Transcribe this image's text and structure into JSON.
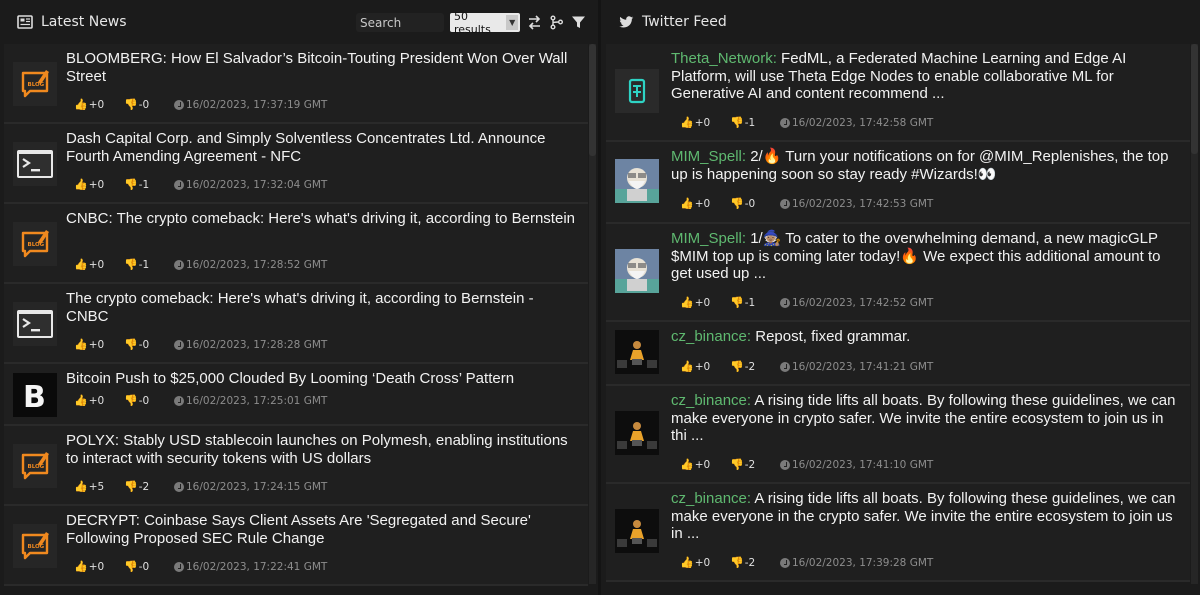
{
  "news": {
    "title": "Latest News",
    "search_placeholder": "Search",
    "results_label": "50 results",
    "items": [
      {
        "title": "BLOOMBERG: How El Salvador’s Bitcoin-Touting President Won Over Wall Street",
        "icon": "blog-icon",
        "up": "+0",
        "down": "-0",
        "time": "16/02/2023, 17:37:19 GMT"
      },
      {
        "title": "Dash Capital Corp. and Simply Solventless Concentrates Ltd. Announce Fourth Amending Agreement - NFC",
        "icon": "terminal-icon",
        "up": "+0",
        "down": "-1",
        "time": "16/02/2023, 17:32:04 GMT"
      },
      {
        "title": "CNBC: The crypto comeback: Here's what's driving it, according to Bernstein",
        "icon": "blog-icon",
        "up": "+0",
        "down": "-1",
        "time": "16/02/2023, 17:28:52 GMT"
      },
      {
        "title": "The crypto comeback: Here's what's driving it, according to Bernstein - CNBC",
        "icon": "terminal-icon",
        "up": "+0",
        "down": "-0",
        "time": "16/02/2023, 17:28:28 GMT"
      },
      {
        "title": "Bitcoin Push to $25,000 Clouded By Looming ‘Death Cross’ Pattern",
        "icon": "b-logo-icon",
        "up": "+0",
        "down": "-0",
        "time": "16/02/2023, 17:25:01 GMT"
      },
      {
        "title": "POLYX: Stably USD stablecoin launches on Polymesh, enabling institutions to interact with security tokens with US dollars",
        "icon": "blog-icon",
        "up": "+5",
        "down": "-2",
        "time": "16/02/2023, 17:24:15 GMT"
      },
      {
        "title": "DECRYPT: Coinbase Says Client Assets Are 'Segregated and Secure' Following Proposed SEC Rule Change",
        "icon": "blog-icon",
        "up": "+0",
        "down": "-0",
        "time": "16/02/2023, 17:22:41 GMT"
      }
    ]
  },
  "twitter": {
    "title": "Twitter Feed",
    "items": [
      {
        "handle": "Theta_Network:",
        "text": " FedML, a Federated Machine Learning and Edge AI Platform, will use Theta Edge Nodes to enable collaborative ML for Generative AI and content recommend ...",
        "icon": "theta-avatar-icon",
        "up": "+0",
        "down": "-1",
        "time": "16/02/2023, 17:42:58 GMT"
      },
      {
        "handle": "MIM_Spell:",
        "text": " 2/🔥 Turn your notifications on for @MIM_Replenishes, the top up is happening soon so stay ready #Wizards!👀",
        "icon": "wizard-avatar-icon",
        "up": "+0",
        "down": "-0",
        "time": "16/02/2023, 17:42:53 GMT"
      },
      {
        "handle": "MIM_Spell:",
        "text": " 1/🧙🏽 To cater to the overwhelming demand, a new magicGLP $MIM top up is coming later today!🔥 We expect this additional amount to get used up ...",
        "icon": "wizard-avatar-icon",
        "up": "+0",
        "down": "-1",
        "time": "16/02/2023, 17:42:52 GMT"
      },
      {
        "handle": "cz_binance:",
        "text": " Repost, fixed grammar.",
        "icon": "cz-avatar-icon",
        "up": "+0",
        "down": "-2",
        "time": "16/02/2023, 17:41:21 GMT"
      },
      {
        "handle": "cz_binance:",
        "text": " A rising tide lifts all boats. By following these guidelines, we can make everyone in crypto safer. We invite the entire ecosystem to join us in thi ...",
        "icon": "cz-avatar-icon",
        "up": "+0",
        "down": "-2",
        "time": "16/02/2023, 17:41:10 GMT"
      },
      {
        "handle": "cz_binance:",
        "text": " A rising tide lifts all boats. By following these guidelines, we can make everyone in the crypto safer. We invite the entire ecosystem to join us in ...",
        "icon": "cz-avatar-icon",
        "up": "+0",
        "down": "-2",
        "time": "16/02/2023, 17:39:28 GMT"
      }
    ]
  },
  "icons": {
    "up": "thumbs-up-icon",
    "down": "thumbs-down-icon",
    "clock": "clock-icon"
  },
  "colors": {
    "handle": "#5fb970",
    "blog": "#f0891f",
    "theta": "#2ed3c4"
  }
}
